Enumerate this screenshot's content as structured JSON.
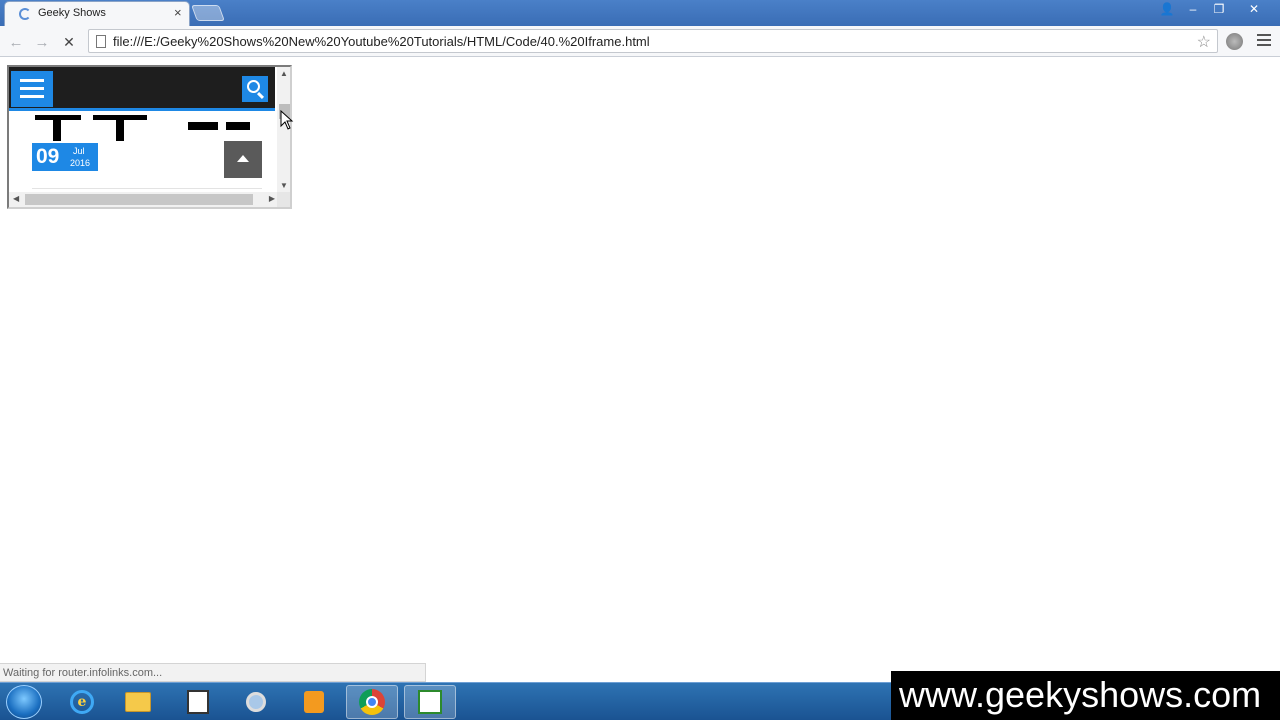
{
  "browser": {
    "tab_title": "Geeky Shows",
    "tab_close": "×",
    "url": "file:///E:/Geeky%20Shows%20New%20Youtube%20Tutorials/HTML/Code/40.%20Iframe.html",
    "status_text": "Waiting for router.infolinks.com...",
    "window_controls": {
      "user": "👤",
      "minimize": "–",
      "maximize": "❐",
      "close": "✕"
    },
    "icons": {
      "back": "back-arrow-icon",
      "forward": "forward-arrow-icon",
      "stop": "stop-icon",
      "bookmark": "star-icon",
      "menu": "hamburger-menu-icon"
    }
  },
  "toolbar": {
    "back": "←",
    "forward": "→",
    "stop": "✕",
    "star": "☆"
  },
  "iframe": {
    "date": {
      "day": "09",
      "month": "Jul",
      "year": "2016"
    },
    "scroll": {
      "up": "▲",
      "down": "▼",
      "left": "◀",
      "right": "▶"
    }
  },
  "watermark": {
    "text": "www.geekyshows.com"
  },
  "colors": {
    "accent": "#1e88e5",
    "header": "#1e1e1e",
    "taskbar": "#2e73b3"
  }
}
